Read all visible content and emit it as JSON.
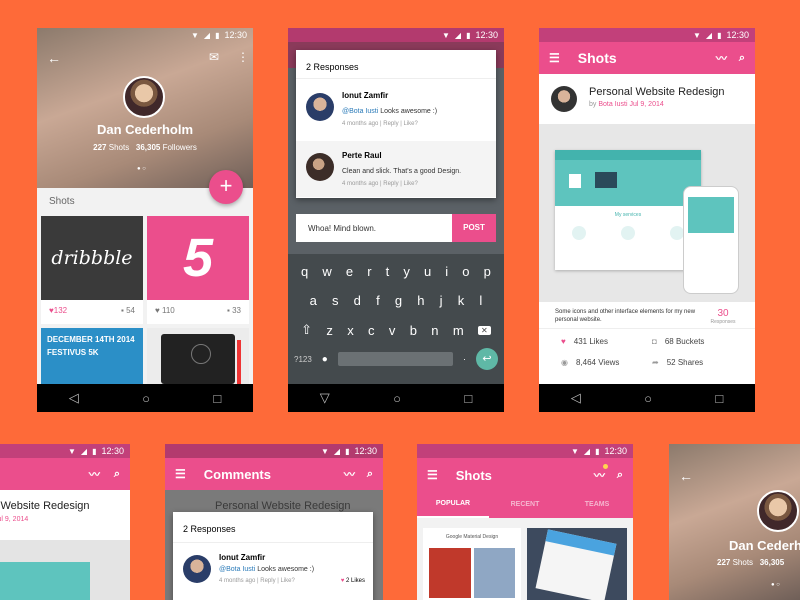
{
  "status": {
    "time": "12:30"
  },
  "profile": {
    "name": "Dan Cederholm",
    "shots_count": "227",
    "shots_label": "Shots",
    "followers_count": "36,305",
    "followers_label": "Followers",
    "section_title": "Shots",
    "fab": "+"
  },
  "profile_shots": [
    {
      "title": "dribbble",
      "likes": "132",
      "comments": "54"
    },
    {
      "title": "5",
      "likes": "110",
      "comments": "33"
    },
    {
      "title": "DECEMBER 14TH 2014 FESTIVUS 5K"
    },
    {
      "title": "notebook"
    }
  ],
  "comments": {
    "responses_title": "2 Responses",
    "items": [
      {
        "author": "Ionut Zamfir",
        "mention": "@Bota Iusti",
        "text": " Looks awesome :)",
        "meta": "4 months ago | Reply | Like?",
        "likes": "2 Likes"
      },
      {
        "author": "Perte Raul",
        "text": "Clean and slick. That's a good Design.",
        "meta": "4 months ago | Reply | Like?"
      }
    ],
    "input_value": "Whoa! Mind blown.",
    "post_label": "POST",
    "header_title": "Comments",
    "bg_title": "Personal Website Redesign"
  },
  "keyboard": {
    "row1": [
      "q",
      "w",
      "e",
      "r",
      "t",
      "y",
      "u",
      "i",
      "o",
      "p"
    ],
    "row2": [
      "a",
      "s",
      "d",
      "f",
      "g",
      "h",
      "j",
      "k",
      "l"
    ],
    "row3": [
      "z",
      "x",
      "c",
      "v",
      "b",
      "n",
      "m"
    ],
    "sym": "?123"
  },
  "shot_detail": {
    "app_title": "Shots",
    "title": "Personal Website Redesign",
    "by": "by",
    "author": "Bota Iusti",
    "date": "Jul 9, 2014",
    "description": "Some icons and other interface elements for my new personal website.",
    "responses_count": "30",
    "responses_label": "Responses",
    "likes": "431 Likes",
    "buckets": "68 Buckets",
    "views": "8,464 Views",
    "shares": "52 Shares",
    "preview_title": "My services"
  },
  "shots_list": {
    "title": "Shots",
    "tabs": [
      "POPULAR",
      "RECENT",
      "TEAMS"
    ],
    "card1": "Google Material Design"
  },
  "colors": {
    "accent": "#eb4e8c",
    "background": "#fe6a39",
    "keyboard": "#444a4d"
  }
}
